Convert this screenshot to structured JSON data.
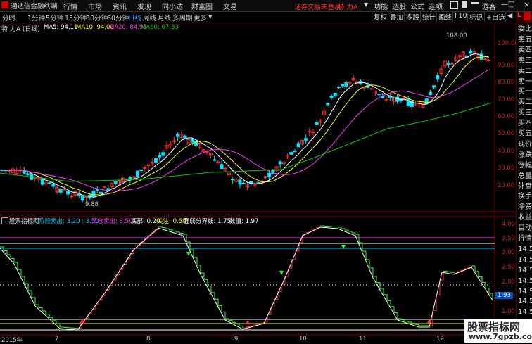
{
  "app": {
    "title": "通达信金融终端",
    "menu": [
      "行情",
      "市场",
      "资讯",
      "发现",
      "同小达",
      "财富圈",
      "交易"
    ],
    "notice": "证券交易未登录",
    "stock_name": "特 力A",
    "right_menu": [
      "功能",
      "选股",
      "公式",
      "选项"
    ],
    "guest": "游客"
  },
  "periods": [
    "分时",
    "1分钟",
    "5分钟",
    "15分钟",
    "30分钟",
    "60分钟",
    "日线",
    "周线",
    "月线",
    "多周期",
    "更多"
  ],
  "active_period": "日线",
  "tools": [
    "复权",
    "叠加",
    "多股",
    "统计",
    "画线",
    "F10",
    "标记",
    "+自选",
    "◀"
  ],
  "main_chart": {
    "title": "特 力A (日线)",
    "ma": [
      {
        "label": "MA5: 94.11",
        "color": "#ffffff"
      },
      {
        "label": "MA10: 94.00",
        "color": "#ffff00"
      },
      {
        "label": "MA20: 84.95",
        "color": "#ff33ff"
      },
      {
        "label": "MA60: 67.33",
        "color": "#00cc00"
      }
    ],
    "high_label": "108.00",
    "low_label": "9.88",
    "y_ticks": [
      "100.00",
      "90.00",
      "80.00",
      "70.00",
      "60.00",
      "50.00",
      "40.00",
      "30.00",
      "20.00"
    ]
  },
  "sub_chart": {
    "title": "股票指标网",
    "items": [
      {
        "label": "阶段卖出: 3.20 : 3.50",
        "color": "#00ccff"
      },
      {
        "label": "清仓卖出: 3.50",
        "color": "#ff33ff"
      },
      {
        "label": "底部: 0.20",
        "color": "#ffffff"
      },
      {
        "label": "关注: 0.50",
        "color": "#ffff00"
      },
      {
        "label": "强弱分界线: 1.75",
        "color": "#ffffff"
      },
      {
        "label": "数值: 1.97",
        "color": "#ffffff"
      }
    ],
    "y_ticks": [
      "4.00",
      "3.50",
      "3.00",
      "2.50",
      "2.00",
      "1.50",
      "1.00"
    ],
    "current_value": "1.93"
  },
  "x_axis": [
    "2015年",
    "7",
    "8",
    "9",
    "10",
    "11",
    "12"
  ],
  "sidebar": [
    "委比",
    "卖五",
    "卖四",
    "卖三",
    "卖二",
    "卖一",
    "买一",
    "买二",
    "买三",
    "买四",
    "买五",
    "现价",
    "涨跌",
    "涨幅",
    "总量",
    "外盘",
    "换手",
    "净资",
    "收益",
    "自动",
    "行情",
    "14:5",
    "14:5",
    "14:5",
    "14:5",
    "14:5",
    "14:5",
    "14:5",
    "14:5",
    "14:5"
  ],
  "watermark": {
    "name": "股票指标网",
    "url": "www.7gpzb.com"
  }
}
